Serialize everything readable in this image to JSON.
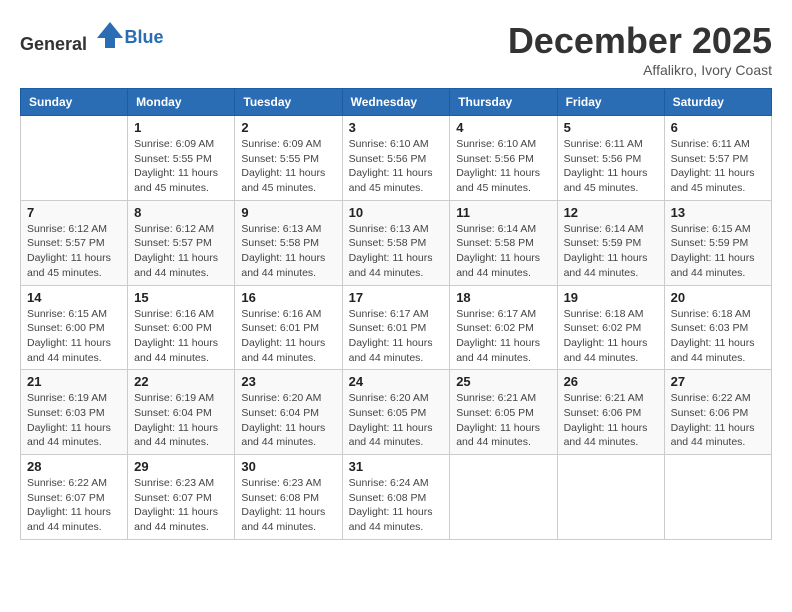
{
  "header": {
    "logo_general": "General",
    "logo_blue": "Blue",
    "month": "December 2025",
    "location": "Affalikro, Ivory Coast"
  },
  "days_of_week": [
    "Sunday",
    "Monday",
    "Tuesday",
    "Wednesday",
    "Thursday",
    "Friday",
    "Saturday"
  ],
  "weeks": [
    [
      {
        "day": "",
        "info": ""
      },
      {
        "day": "1",
        "info": "Sunrise: 6:09 AM\nSunset: 5:55 PM\nDaylight: 11 hours and 45 minutes."
      },
      {
        "day": "2",
        "info": "Sunrise: 6:09 AM\nSunset: 5:55 PM\nDaylight: 11 hours and 45 minutes."
      },
      {
        "day": "3",
        "info": "Sunrise: 6:10 AM\nSunset: 5:56 PM\nDaylight: 11 hours and 45 minutes."
      },
      {
        "day": "4",
        "info": "Sunrise: 6:10 AM\nSunset: 5:56 PM\nDaylight: 11 hours and 45 minutes."
      },
      {
        "day": "5",
        "info": "Sunrise: 6:11 AM\nSunset: 5:56 PM\nDaylight: 11 hours and 45 minutes."
      },
      {
        "day": "6",
        "info": "Sunrise: 6:11 AM\nSunset: 5:57 PM\nDaylight: 11 hours and 45 minutes."
      }
    ],
    [
      {
        "day": "7",
        "info": "Sunrise: 6:12 AM\nSunset: 5:57 PM\nDaylight: 11 hours and 45 minutes."
      },
      {
        "day": "8",
        "info": "Sunrise: 6:12 AM\nSunset: 5:57 PM\nDaylight: 11 hours and 44 minutes."
      },
      {
        "day": "9",
        "info": "Sunrise: 6:13 AM\nSunset: 5:58 PM\nDaylight: 11 hours and 44 minutes."
      },
      {
        "day": "10",
        "info": "Sunrise: 6:13 AM\nSunset: 5:58 PM\nDaylight: 11 hours and 44 minutes."
      },
      {
        "day": "11",
        "info": "Sunrise: 6:14 AM\nSunset: 5:58 PM\nDaylight: 11 hours and 44 minutes."
      },
      {
        "day": "12",
        "info": "Sunrise: 6:14 AM\nSunset: 5:59 PM\nDaylight: 11 hours and 44 minutes."
      },
      {
        "day": "13",
        "info": "Sunrise: 6:15 AM\nSunset: 5:59 PM\nDaylight: 11 hours and 44 minutes."
      }
    ],
    [
      {
        "day": "14",
        "info": "Sunrise: 6:15 AM\nSunset: 6:00 PM\nDaylight: 11 hours and 44 minutes."
      },
      {
        "day": "15",
        "info": "Sunrise: 6:16 AM\nSunset: 6:00 PM\nDaylight: 11 hours and 44 minutes."
      },
      {
        "day": "16",
        "info": "Sunrise: 6:16 AM\nSunset: 6:01 PM\nDaylight: 11 hours and 44 minutes."
      },
      {
        "day": "17",
        "info": "Sunrise: 6:17 AM\nSunset: 6:01 PM\nDaylight: 11 hours and 44 minutes."
      },
      {
        "day": "18",
        "info": "Sunrise: 6:17 AM\nSunset: 6:02 PM\nDaylight: 11 hours and 44 minutes."
      },
      {
        "day": "19",
        "info": "Sunrise: 6:18 AM\nSunset: 6:02 PM\nDaylight: 11 hours and 44 minutes."
      },
      {
        "day": "20",
        "info": "Sunrise: 6:18 AM\nSunset: 6:03 PM\nDaylight: 11 hours and 44 minutes."
      }
    ],
    [
      {
        "day": "21",
        "info": "Sunrise: 6:19 AM\nSunset: 6:03 PM\nDaylight: 11 hours and 44 minutes."
      },
      {
        "day": "22",
        "info": "Sunrise: 6:19 AM\nSunset: 6:04 PM\nDaylight: 11 hours and 44 minutes."
      },
      {
        "day": "23",
        "info": "Sunrise: 6:20 AM\nSunset: 6:04 PM\nDaylight: 11 hours and 44 minutes."
      },
      {
        "day": "24",
        "info": "Sunrise: 6:20 AM\nSunset: 6:05 PM\nDaylight: 11 hours and 44 minutes."
      },
      {
        "day": "25",
        "info": "Sunrise: 6:21 AM\nSunset: 6:05 PM\nDaylight: 11 hours and 44 minutes."
      },
      {
        "day": "26",
        "info": "Sunrise: 6:21 AM\nSunset: 6:06 PM\nDaylight: 11 hours and 44 minutes."
      },
      {
        "day": "27",
        "info": "Sunrise: 6:22 AM\nSunset: 6:06 PM\nDaylight: 11 hours and 44 minutes."
      }
    ],
    [
      {
        "day": "28",
        "info": "Sunrise: 6:22 AM\nSunset: 6:07 PM\nDaylight: 11 hours and 44 minutes."
      },
      {
        "day": "29",
        "info": "Sunrise: 6:23 AM\nSunset: 6:07 PM\nDaylight: 11 hours and 44 minutes."
      },
      {
        "day": "30",
        "info": "Sunrise: 6:23 AM\nSunset: 6:08 PM\nDaylight: 11 hours and 44 minutes."
      },
      {
        "day": "31",
        "info": "Sunrise: 6:24 AM\nSunset: 6:08 PM\nDaylight: 11 hours and 44 minutes."
      },
      {
        "day": "",
        "info": ""
      },
      {
        "day": "",
        "info": ""
      },
      {
        "day": "",
        "info": ""
      }
    ]
  ]
}
